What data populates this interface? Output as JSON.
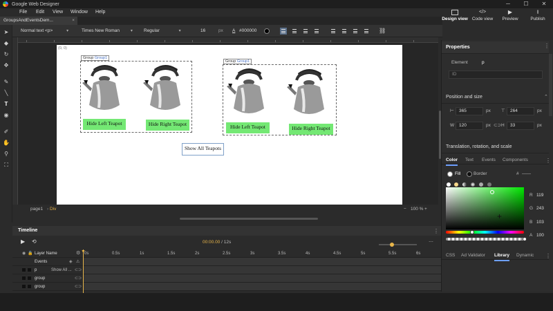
{
  "app": {
    "title": "Google Web Designer"
  },
  "menu": [
    "File",
    "Edit",
    "View",
    "Window",
    "Help"
  ],
  "doc_tab": {
    "label": "GroupsAndEventsDem...",
    "close": "×"
  },
  "top_buttons": [
    {
      "label": "Design view",
      "active": true
    },
    {
      "label": "Code view",
      "active": false
    },
    {
      "label": "Preview",
      "active": false
    },
    {
      "label": "Publish",
      "active": false
    }
  ],
  "prop_toolbar": {
    "format": "Normal text <p>",
    "font": "Times New Roman",
    "weight": "Regular",
    "size": "16",
    "unit": "px",
    "color": "#000000"
  },
  "stage": {
    "coords": "(0, 0)",
    "groups": [
      {
        "label": "Group",
        "name": "Group1",
        "left_button": "Hide Left Teapot",
        "right_button": "Hide Right Teapot"
      },
      {
        "label": "Group",
        "name": "Group1",
        "left_button": "Hide Left Teapot",
        "right_button": "Hide Right Teapot"
      }
    ],
    "show_all": "Show All Teapots"
  },
  "stage_bar": {
    "page": "page1",
    "element": "Div",
    "zoom": "100 %"
  },
  "panel": {
    "title": "Properties",
    "element_label": "Element",
    "element_value": "p",
    "id_placeholder": "ID",
    "pos_size_title": "Position and size",
    "left": "365",
    "top": "264",
    "w_label": "W",
    "w": "120",
    "h_label": "H",
    "h": "33",
    "unit": "px",
    "transform_title": "Translation, rotation, and scale",
    "tabs": [
      "Color",
      "Text",
      "Events",
      "Components"
    ],
    "fill_label": "Fill",
    "border_label": "Border",
    "hex_symbol": "#",
    "hex_value": "——",
    "rgba": {
      "R": "119",
      "G": "243",
      "B": "103",
      "A": "100"
    },
    "bottom_tabs": [
      "CSS",
      "Ad Validator",
      "Library",
      "Dynamic"
    ]
  },
  "timeline": {
    "title": "Timeline",
    "time": "00:00.00",
    "total": "/ 12s",
    "header_layer": "Layer Name",
    "ticks": [
      "0s",
      "0.5s",
      "1s",
      "1.5s",
      "2s",
      "2.5s",
      "3s",
      "3.5s",
      "4s",
      "4.5s",
      "5s",
      "5.5s",
      "6s"
    ],
    "rows": [
      {
        "name": "Events",
        "meta": ""
      },
      {
        "name": "p",
        "meta": "Show All ..."
      },
      {
        "name": "group",
        "meta": ""
      },
      {
        "name": "group",
        "meta": ""
      }
    ]
  },
  "colors": {
    "accent": "#e8b54a",
    "button_green": "#74e874",
    "group_link": "#4a72c4",
    "selected_color": "#77f367"
  }
}
